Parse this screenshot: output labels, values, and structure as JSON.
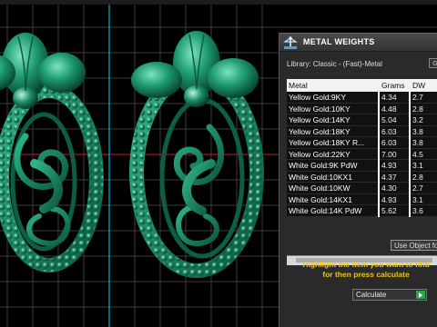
{
  "panel": {
    "title": "METAL WEIGHTS",
    "library": "Library: Classic - (Fast)-Metal",
    "table": {
      "headers": [
        "Metal",
        "Grams",
        "DW"
      ],
      "rows": [
        {
          "metal": "Yellow Gold:9KY",
          "grams": "4.34",
          "dw": "2.7"
        },
        {
          "metal": "Yellow Gold:10KY",
          "grams": "4.48",
          "dw": "2.8"
        },
        {
          "metal": "Yellow Gold:14KY",
          "grams": "5.04",
          "dw": "3.2"
        },
        {
          "metal": "Yellow Gold:18KY",
          "grams": "6.03",
          "dw": "3.8"
        },
        {
          "metal": "Yellow Gold:18KY R...",
          "grams": "6.03",
          "dw": "3.8"
        },
        {
          "metal": "Yellow Gold:22KY",
          "grams": "7.00",
          "dw": "4.5"
        },
        {
          "metal": "White Gold:9K PdW",
          "grams": "4.93",
          "dw": "3.1"
        },
        {
          "metal": "White Gold:10KX1",
          "grams": "4.37",
          "grams_note": "",
          "dw": "2.8"
        },
        {
          "metal": "White Gold:10KW",
          "grams": "4.30",
          "dw": "2.7"
        },
        {
          "metal": "White Gold:14KX1",
          "grams": "4.93",
          "dw": "3.1"
        },
        {
          "metal": "White Gold:14K PdW",
          "grams": "5.62",
          "dw": "3.6"
        }
      ]
    },
    "use_object_label": "Use Object fo",
    "hint_line1": "Highlight the item you want to find",
    "hint_line2": "for then press calculate",
    "calculate_label": "Calculate"
  },
  "colors": {
    "accent_hint": "#f2c500",
    "jewel_green": "#1b8a66",
    "grid": "#3c3c3c",
    "cyan_axis": "#00b4c8",
    "red_axis": "#c81e1e"
  }
}
